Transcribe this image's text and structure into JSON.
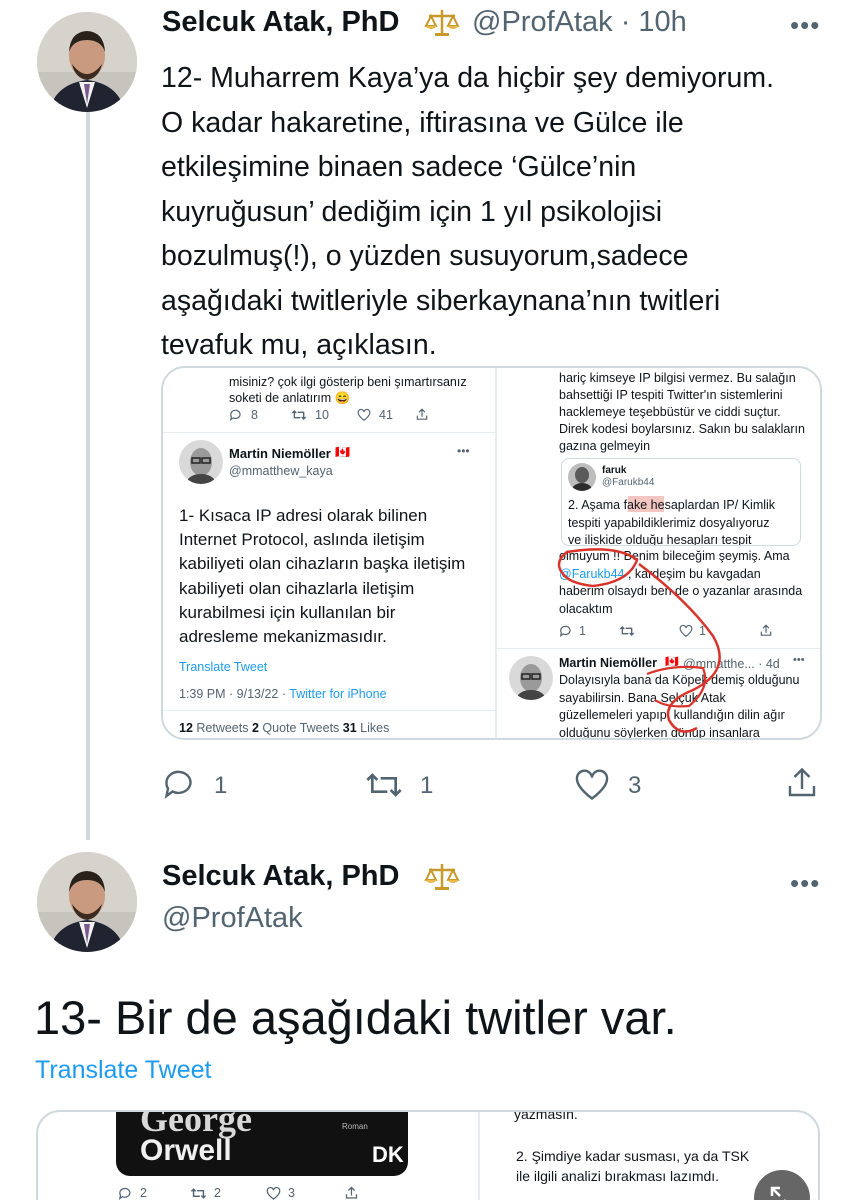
{
  "tweet1": {
    "author_name": "Selcuk Atak, PhD",
    "handle_time": "@ProfAtak · 10h",
    "text_lines": [
      "12- Muharrem Kaya’ya da hiçbir şey demiyorum.",
      "O kadar hakaretine, iftirasına ve Gülce ile",
      "etkileşimine binaen sadece ‘Gülce’nin",
      "kuyruğusun’ dediğim için 1 yıl psikolojisi",
      "bozulmuş(!), o yüzden susuyorum,sadece",
      "aşağıdaki twitleriyle siberkaynana’nın twitleri",
      "tevafuk mu, açıklasın."
    ],
    "reply_count": "1",
    "retweet_count": "1",
    "like_count": "3"
  },
  "media1": {
    "left": {
      "top_text_1": "misiniz? çok ilgi gösterip beni şımartırsanız",
      "top_text_2": "soketi de anlatırım 😄",
      "top_counts": [
        "8",
        "10",
        "41"
      ],
      "author_name": "Martin Niemöller",
      "author_handle": "@mmatthew_kaya",
      "flag": "🇨🇦",
      "body_lines": [
        "1- Kısaca IP adresi olarak bilinen",
        "Internet Protocol, aslında iletişim",
        "kabiliyeti olan cihazların başka iletişim",
        "kabiliyeti olan cihazlarla iletişim",
        "kurabilmesi için kullanılan bir",
        "adresleme mekanizmasıdır."
      ],
      "translate": "Translate Tweet",
      "meta_time": "1:39 PM · 9/13/22 · ",
      "meta_source": "Twitter for iPhone",
      "stats": [
        {
          "num": "12",
          "label": " Retweets "
        },
        {
          "num": "2",
          "label": " Quote Tweets "
        },
        {
          "num": "31",
          "label": " Likes"
        }
      ]
    },
    "right": {
      "top_lines": [
        "hariç kimseye IP bilgisi vermez. Bu salağın",
        "bahsettiği IP tespiti Twitter'ın sistemlerini",
        "hacklemeye teşebbüstür ve ciddi suçtur.",
        "Direk kodesi boylarsınız. Sakın bu salakların",
        "gazına gelmeyin"
      ],
      "quote_name": "faruk",
      "quote_handle": "@Farukb44",
      "quote_lines": [
        "2. Aşama fake hesaplardan IP/ Kimlik",
        "tespiti yapabildiklerimiz dosyalıyoruz",
        "ve ilişkide olduğu hesapları tespit"
      ],
      "reply_line_1": "olmuyum !! Benim bileceğim şeymiş. Ama",
      "reply_mention": "@Farukb44",
      "reply_line_2_rest": " , kardeşim bu kavgadan",
      "reply_line_3": "haberim olsaydı ben de o yazanlar arasında",
      "reply_line_4": "olacaktım",
      "reply_counts": [
        "1",
        "1"
      ],
      "bottom_name": "Martin Niemöller",
      "bottom_handle_time": "@mmatthe... · 4d",
      "bottom_lines": [
        "Dolayısıyla bana da Köpek demiş olduğunu",
        "sayabilirsin. Bana Selçuk Atak",
        "güzellemeleri yapıp, kullandığın dilin ağır",
        "olduğunu söylerken dönüp insanlara"
      ]
    }
  },
  "tweet2": {
    "author_name": "Selcuk Atak, PhD",
    "handle": "@ProfAtak",
    "text": "13- Bir de aşağıdaki twitler var.",
    "translate": "Translate Tweet"
  },
  "media2": {
    "book_line_1": "George",
    "book_line_2": "Orwell",
    "book_small": "Roman",
    "book_logo": "DK",
    "counts": [
      "2",
      "2",
      "3"
    ],
    "right_line_0": "yazmasın.",
    "right_line_1": "2. Şimdiye kadar susması, ya da TSK",
    "right_line_2": "ile ilgili analizi bırakması lazımdı."
  },
  "colors": {
    "link_blue": "#1d9bf0",
    "secondary_gray": "#536471",
    "annotation_red": "#d9342b",
    "highlight": "#f4c6c2"
  }
}
